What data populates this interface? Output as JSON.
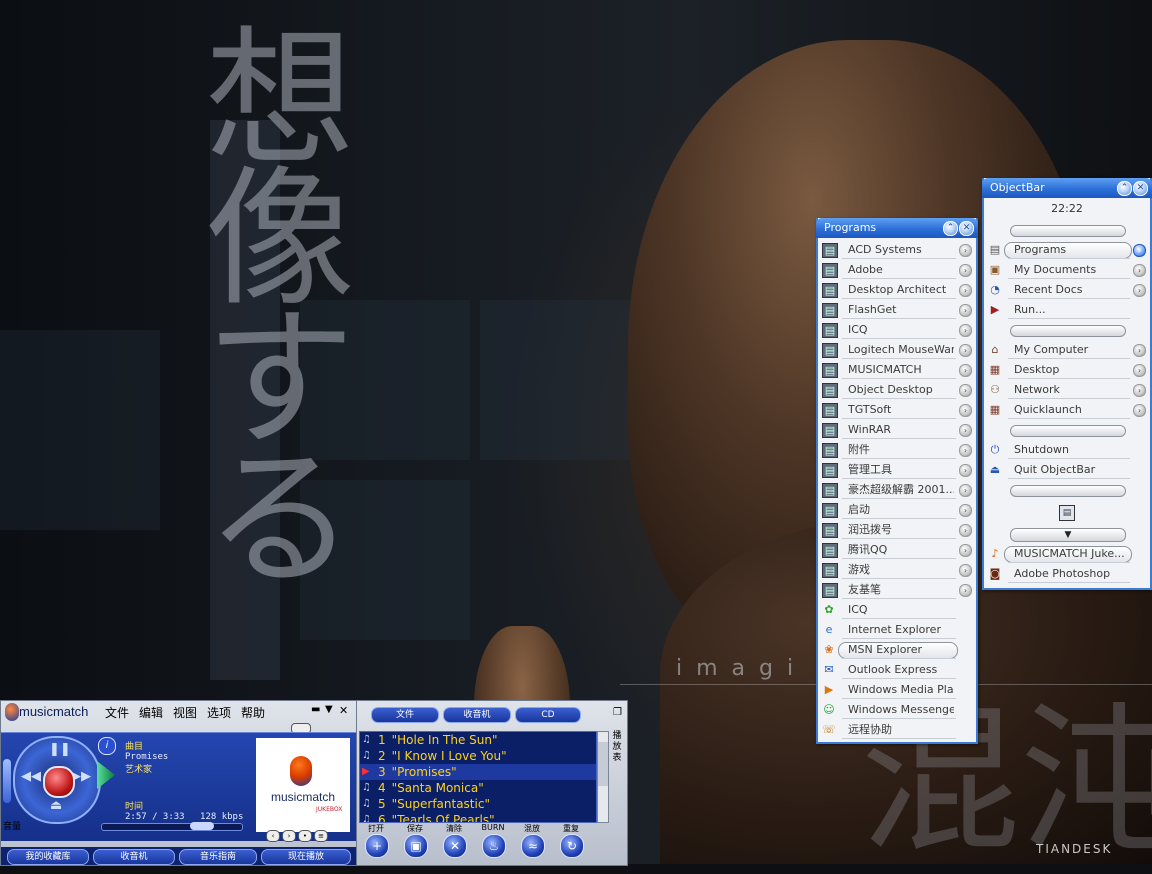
{
  "wallpaper": {
    "kanji_text": "想像する",
    "overlay_word": "imagi s",
    "bottom_right_text": "混沌",
    "brand": "TIANDESK"
  },
  "programs_bar": {
    "title": "Programs",
    "items": [
      {
        "label": "ACD Systems",
        "icon": "program-group-icon"
      },
      {
        "label": "Adobe",
        "icon": "program-group-icon"
      },
      {
        "label": "Desktop Architect",
        "icon": "program-group-icon"
      },
      {
        "label": "FlashGet",
        "icon": "program-group-icon"
      },
      {
        "label": "ICQ",
        "icon": "program-group-icon"
      },
      {
        "label": "Logitech MouseWare",
        "icon": "program-group-icon"
      },
      {
        "label": "MUSICMATCH",
        "icon": "program-group-icon"
      },
      {
        "label": "Object Desktop",
        "icon": "program-group-icon"
      },
      {
        "label": "TGTSoft",
        "icon": "program-group-icon"
      },
      {
        "label": "WinRAR",
        "icon": "program-group-icon"
      },
      {
        "label": "附件",
        "icon": "program-group-icon"
      },
      {
        "label": "管理工具",
        "icon": "program-group-icon"
      },
      {
        "label": "豪杰超级解霸 2001...",
        "icon": "program-group-icon"
      },
      {
        "label": "启动",
        "icon": "program-group-icon"
      },
      {
        "label": "润迅拨号",
        "icon": "program-group-icon"
      },
      {
        "label": "腾讯QQ",
        "icon": "program-group-icon"
      },
      {
        "label": "游戏",
        "icon": "program-group-icon"
      },
      {
        "label": "友基笔",
        "icon": "program-group-icon"
      }
    ],
    "shortcuts": [
      {
        "label": "ICQ",
        "icon": "icq-flower-icon"
      },
      {
        "label": "Internet Explorer",
        "icon": "ie-icon"
      },
      {
        "label": "MSN Explorer",
        "icon": "msn-butterfly-icon"
      },
      {
        "label": "Outlook Express",
        "icon": "outlook-icon"
      },
      {
        "label": "Windows Media Pla...",
        "icon": "media-player-icon"
      },
      {
        "label": "Windows Messenger",
        "icon": "messenger-icon"
      },
      {
        "label": "远程协助",
        "icon": "remote-assist-icon"
      }
    ]
  },
  "object_bar": {
    "title": "ObjectBar",
    "clock": "22:22",
    "group1": [
      {
        "label": "Programs",
        "icon": "programs-icon"
      },
      {
        "label": "My Documents",
        "icon": "documents-icon"
      },
      {
        "label": "Recent Docs",
        "icon": "recent-docs-icon"
      },
      {
        "label": "Run...",
        "icon": "run-icon"
      }
    ],
    "group2": [
      {
        "label": "My Computer",
        "icon": "computer-icon"
      },
      {
        "label": "Desktop",
        "icon": "desktop-icon"
      },
      {
        "label": "Network",
        "icon": "network-icon"
      },
      {
        "label": "Quicklaunch",
        "icon": "quicklaunch-icon"
      }
    ],
    "group3": [
      {
        "label": "Shutdown",
        "icon": "shutdown-icon"
      },
      {
        "label": "Quit ObjectBar",
        "icon": "quit-icon"
      }
    ],
    "pinned": [
      {
        "label": "MUSICMATCH Juke...",
        "icon": "musicmatch-icon"
      },
      {
        "label": "Adobe Photoshop",
        "icon": "photoshop-icon"
      }
    ]
  },
  "musicmatch": {
    "brand": "musicmatch",
    "menu": [
      "文件",
      "编辑",
      "视图",
      "选项",
      "帮助"
    ],
    "track_label": "曲目",
    "track_name": "Promises",
    "artist_label": "艺术家",
    "time_label": "时间",
    "time": "2:57 / 3:33",
    "bitrate": "128 kbps",
    "volume_label": "音量",
    "logo_text": "musicmatch",
    "logo_sub": "JUKEBOX",
    "bottom_buttons": [
      "我的收藏库",
      "收音机",
      "音乐指南",
      "现在播放"
    ]
  },
  "playlist": {
    "tabs": [
      "文件",
      "收音机",
      "CD"
    ],
    "rows": [
      {
        "num": "1",
        "title": "\"Hole In The Sun\""
      },
      {
        "num": "2",
        "title": "\"I Know I Love You\""
      },
      {
        "num": "3",
        "title": "\"Promises\""
      },
      {
        "num": "4",
        "title": "\"Santa Monica\""
      },
      {
        "num": "5",
        "title": "\"Superfantastic\""
      },
      {
        "num": "6",
        "title": "\"Tearls Of Pearls\""
      }
    ],
    "selected_index": 2,
    "side_label": "播放表",
    "buttons": [
      {
        "label": "打开",
        "glyph": "+"
      },
      {
        "label": "保存",
        "glyph": "▣"
      },
      {
        "label": "清除",
        "glyph": "✕"
      },
      {
        "label": "BURN",
        "glyph": "♨"
      },
      {
        "label": "混放",
        "glyph": "≈"
      },
      {
        "label": "重复",
        "glyph": "↻"
      }
    ]
  }
}
